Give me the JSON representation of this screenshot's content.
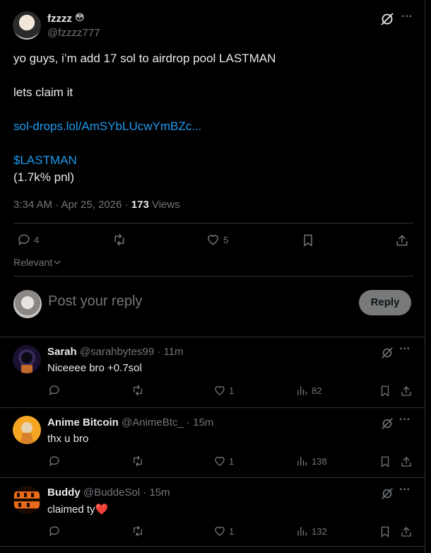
{
  "post": {
    "author_name": "fzzzz",
    "author_emoji": "😳",
    "author_handle": "@fzzzz777",
    "line1": "yo guys, i’m add 17 sol to airdrop pool LASTMAN",
    "line2": "lets claim it",
    "link": "sol-drops.lol/AmSYbLUcwYmBZc...",
    "cashtag": "$LASTMAN",
    "pnl": "(1.7k% pnl)",
    "time": "3:34 AM · Apr 25, 2026 · ",
    "views_count": "173",
    "views_label": " Views",
    "replies": "4",
    "likes": "5"
  },
  "sort": {
    "label": "Relevant"
  },
  "reply_box": {
    "placeholder": "Post your reply",
    "button": "Reply"
  },
  "comments": [
    {
      "name": "Sarah",
      "handle": "@sarahbytes99 · 11m",
      "text": "Niceeee bro +0.7sol",
      "likes": "1",
      "views": "82"
    },
    {
      "name": "Anime Bitcoin",
      "handle": "@AnimeBtc_ · 15m",
      "text": "thx u bro",
      "likes": "1",
      "views": "138"
    },
    {
      "name": "Buddy",
      "handle": "@BuddeSol · 15m",
      "text": "claimed ty",
      "heart": "❤️",
      "likes": "1",
      "views": "132"
    }
  ],
  "colors": {
    "background": "#000000",
    "text": "#e7e9ea",
    "muted": "#71767b",
    "link": "#1d9bf0",
    "divider": "#2f3336"
  }
}
